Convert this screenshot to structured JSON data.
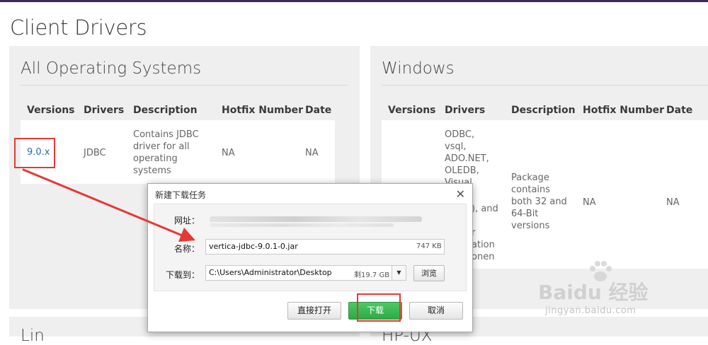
{
  "page": {
    "title": "Client Drivers"
  },
  "panels": {
    "all_os": {
      "title": "All Operating Systems",
      "headers": [
        "Versions",
        "Drivers",
        "Description",
        "Hotfix Number",
        "Date"
      ],
      "row": {
        "version": "9.0.x",
        "driver": "JDBC",
        "description": "Contains JDBC driver for all operating systems",
        "hotfix": "NA",
        "date": "NA"
      }
    },
    "windows": {
      "title": "Windows",
      "headers": [
        "Versions",
        "Drivers",
        "Description",
        "Hotfix Number",
        "Date"
      ],
      "row": {
        "drivers_visible": "ODBC, vsql, ADO.NET, OLEDB, Visual",
        "drivers_partial": "), and",
        "drivers_partial2": "r",
        "drivers_partial3": "ation",
        "drivers_partial4": "onen",
        "description": "Package contains both 32 and 64-Bit versions",
        "hotfix": "NA",
        "date": "NA"
      }
    },
    "bottom_left_fragment": "Lin",
    "bottom_right_fragment": "HP-UX"
  },
  "dialog": {
    "title": "新建下载任务",
    "url_label": "网址：",
    "name_label": "名称：",
    "name_value": "vertica-jdbc-9.0.1-0.jar",
    "file_size": "747 KB",
    "saveto_label": "下载到：",
    "saveto_value": "C:\\Users\\Administrator\\Desktop",
    "free_space": "剩19.7 GB",
    "browse_label": "浏览",
    "open_direct_label": "直接打开",
    "download_label": "下载",
    "cancel_label": "取消"
  },
  "watermark": {
    "brand": "Baidu 经验",
    "url": "jingyan.baidu.com"
  },
  "colors": {
    "accent_link": "#2a6ebb",
    "highlight": "#e53935",
    "primary_button": "#2eaa48",
    "topbar": "#3a2a55"
  }
}
